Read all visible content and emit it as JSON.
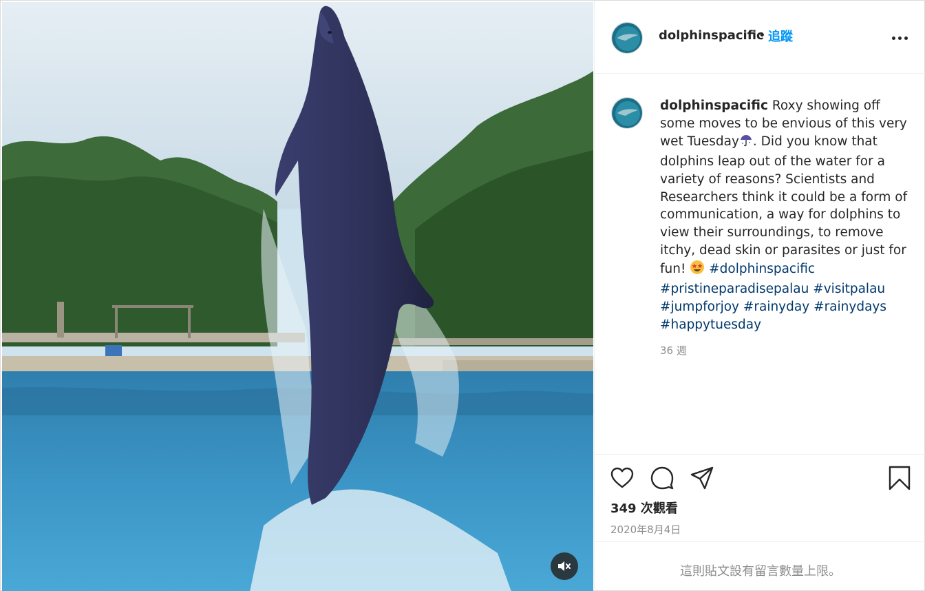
{
  "post": {
    "media": {
      "subject": "dolphin-leaping-photo",
      "mute_icon": "speaker-muted-icon"
    },
    "header": {
      "username": "dolphinspacific",
      "separator": "•",
      "follow_label": "追蹤",
      "more_icon": "more-options-icon"
    },
    "caption": {
      "username": "dolphinspacific",
      "text_part1": "Roxy showing off some moves to be envious of this very wet Tuesday",
      "emoji1": "umbrella-rain-emoji",
      "text_part2": ". Did you know that dolphins leap out of the water for a variety of reasons? Scientists and Researchers think it could be a form of communication, a way for dolphins to view their surroundings, to remove itchy, dead skin or parasites or just for fun!",
      "emoji2": "star-struck-emoji",
      "hashtags": [
        "#dolphinspacific",
        "#pristineparadisepalau",
        "#visitpalau",
        "#jumpforjoy",
        "#rainyday",
        "#rainydays",
        "#happytuesday"
      ],
      "time_ago": "36 週"
    },
    "actions": {
      "like_icon": "heart-icon",
      "comment_icon": "comment-icon",
      "share_icon": "share-icon",
      "save_icon": "bookmark-icon",
      "views": "349 次觀看",
      "date": "2020年8月4日"
    },
    "footer": {
      "notice": "這則貼文設有留言數量上限。"
    }
  }
}
